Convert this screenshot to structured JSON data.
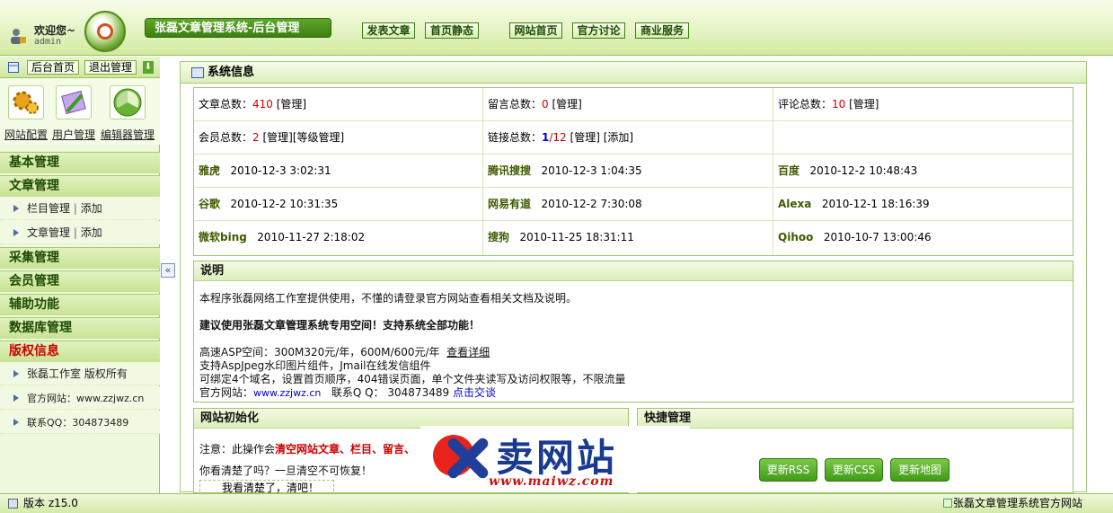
{
  "header": {
    "welcome": "欢迎您~",
    "username": "admin",
    "title": "张磊文章管理系统-后台管理",
    "nav": [
      "发表文章",
      "首页静态",
      "网站首页",
      "官方讨论",
      "商业服务"
    ]
  },
  "sidebar": {
    "top_buttons": [
      "后台首页",
      "退出管理"
    ],
    "icon_labels": [
      "网站配置",
      "用户管理",
      "编辑器管理"
    ],
    "categories": {
      "basic": "基本管理",
      "article": "文章管理",
      "collect": "采集管理",
      "member": "会员管理",
      "assist": "辅助功能",
      "database": "数据库管理",
      "copyright": "版权信息"
    },
    "article_items": [
      {
        "label": "栏目管理",
        "add": "添加"
      },
      {
        "label": "文章管理",
        "add": "添加"
      }
    ],
    "copyright_items": [
      "张磊工作室 版权所有",
      "官方网站：www.zzjwz.cn",
      "联系QQ：304873489"
    ],
    "separator": "|"
  },
  "main": {
    "panel_title": "系统信息",
    "stats": {
      "article_label": "文章总数：",
      "article_count": "410",
      "message_label": "留言总数：",
      "message_count": "0",
      "comment_label": "评论总数：",
      "comment_count": "10",
      "manage_link": "[管理]",
      "member_label": "会员总数：",
      "member_count": "2",
      "level_link": "[等级管理]",
      "link_label": "链接总数：",
      "link_count_a": "1",
      "link_count_b": "/12",
      "add_link": "[添加]"
    },
    "engines": [
      {
        "name": "雅虎",
        "time": "2010-12-3 3:02:31"
      },
      {
        "name": "腾讯搜搜",
        "time": "2010-12-3 1:04:35"
      },
      {
        "name": "百度",
        "time": "2010-12-2 10:48:43"
      },
      {
        "name": "谷歌",
        "time": "2010-12-2 10:31:35"
      },
      {
        "name": "网易有道",
        "time": "2010-12-2 7:30:08"
      },
      {
        "name": "Alexa",
        "time": "2010-12-1 18:16:39"
      },
      {
        "name": "微软bing",
        "time": "2010-11-27 2:18:02"
      },
      {
        "name": "搜狗",
        "time": "2010-11-25 18:31:11"
      },
      {
        "name": "Qihoo",
        "time": "2010-10-7 13:00:46"
      }
    ],
    "notes": {
      "title": "说明",
      "line1": "本程序张磊网络工作室提供使用，不懂的请登录官方网站查看相关文档及说明。",
      "line2": "建议使用张磊文章管理系统专用空间！支持系统全部功能！",
      "line3": "高速ASP空间：300M320元/年，600M/600元/年",
      "line3_link": "查看详细",
      "line4": "支持AspJpeg水印图片组件，Jmail在线发信组件",
      "line5": "可绑定4个域名，设置首页顺序，404错误页面，单个文件夹读写及访问权限等，不限流量",
      "line6_label": "官方网站：",
      "line6_site": "www.zzjwz.cn",
      "line6_qq_label": "联系Q Q：",
      "line6_qq": "304873489",
      "line6_talk": "点击交谈"
    },
    "init": {
      "title": "网站初始化",
      "warn_prefix": "注意：此操作会",
      "warn_red": "清空网站文章、栏目、留言、",
      "confirm_q": "你看清楚了吗？一旦清空不可恢复！",
      "confirm_btn": "我看清楚了，清吧！"
    },
    "quick": {
      "title": "快捷管理",
      "buttons": [
        "更新RSS",
        "更新CSS",
        "更新地图"
      ]
    }
  },
  "watermark": {
    "text": "卖网站",
    "url": "www.maiwz.com"
  },
  "footer": {
    "version": "版本 z15.0",
    "official": "张磊文章管理系统官方网站"
  }
}
